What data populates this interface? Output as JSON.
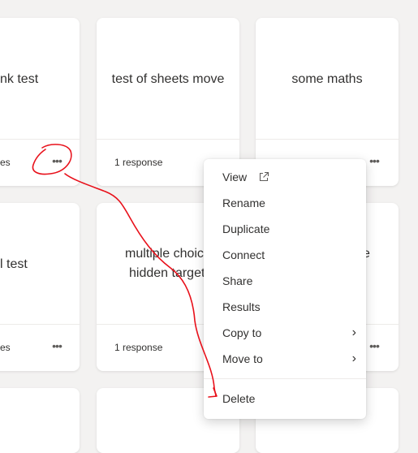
{
  "cards": [
    {
      "title": "nk test",
      "response": "es"
    },
    {
      "title": "test of sheets move",
      "response": "1 response"
    },
    {
      "title": "some maths",
      "response": ""
    },
    {
      "title": "l test",
      "response": "es"
    },
    {
      "title_line1": "multiple choic",
      "title_line2": "hidden target",
      "response": "1 response"
    },
    {
      "title": "e",
      "response": ""
    }
  ],
  "more_label": "•••",
  "menu": {
    "items": [
      {
        "label": "View"
      },
      {
        "label": "Rename"
      },
      {
        "label": "Duplicate"
      },
      {
        "label": "Connect"
      },
      {
        "label": "Share"
      },
      {
        "label": "Results"
      },
      {
        "label": "Copy to"
      },
      {
        "label": "Move to"
      },
      {
        "label": "Delete"
      }
    ],
    "chevron": "›"
  },
  "colors": {
    "background": "#f3f2f1",
    "card": "#ffffff",
    "annotation": "#e8101a"
  },
  "icons": [
    "external-link-icon",
    "chevron-right-icon",
    "more-options-icon"
  ]
}
